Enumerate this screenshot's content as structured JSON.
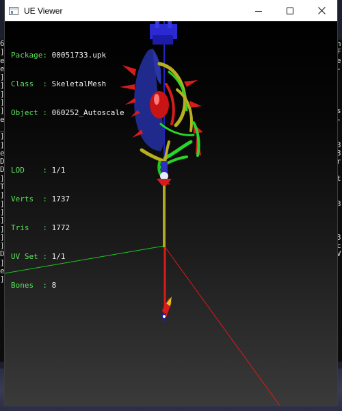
{
  "window": {
    "title": "UE Viewer",
    "controls": {
      "minimize": "minimize-icon",
      "maximize": "maximize-icon",
      "close": "close-icon"
    }
  },
  "info": {
    "package": {
      "label": "Package",
      "value": "00051733.upk"
    },
    "class": {
      "label": "Class  ",
      "value": "SkeletalMesh"
    },
    "object": {
      "label": "Object ",
      "value": "060252_Autoscale"
    },
    "lod": {
      "label": "LOD    ",
      "value": "1/1"
    },
    "verts": {
      "label": "Verts  ",
      "value": "1737"
    },
    "tris": {
      "label": "Tris   ",
      "value": "1772"
    },
    "uvset": {
      "label": "UV Set ",
      "value": "1/1"
    },
    "bones": {
      "label": "Bones  ",
      "value": "8"
    }
  },
  "background_terminal": {
    "left_glyphs": [
      "6",
      "]",
      "e",
      "e",
      "]",
      "]",
      "]",
      "]",
      "]",
      "e",
      "_",
      "]",
      "]",
      "e",
      "D",
      "D",
      "]",
      "T",
      "]",
      "]",
      "]",
      "]",
      "]",
      "]",
      "]",
      "D",
      "]",
      "e",
      "]"
    ],
    "right_glyphs": [
      "n",
      "F",
      "e",
      "-",
      "",
      "",
      "",
      "",
      "s",
      "-",
      "",
      "",
      "3",
      "3",
      "r",
      "",
      "t",
      "",
      "",
      "3",
      "",
      "",
      "",
      "3",
      "c",
      "V"
    ]
  },
  "colors": {
    "info_label": "#5ce05c",
    "info_value": "#f2f2f2",
    "axis_x": "#e01818",
    "axis_y": "#1ec81e",
    "axis_z": "#2020c8",
    "mesh_blue": "#1f2a8c",
    "mesh_red": "#d81c1c",
    "mesh_green": "#2ad42a",
    "mesh_yellow": "#b8b020"
  }
}
